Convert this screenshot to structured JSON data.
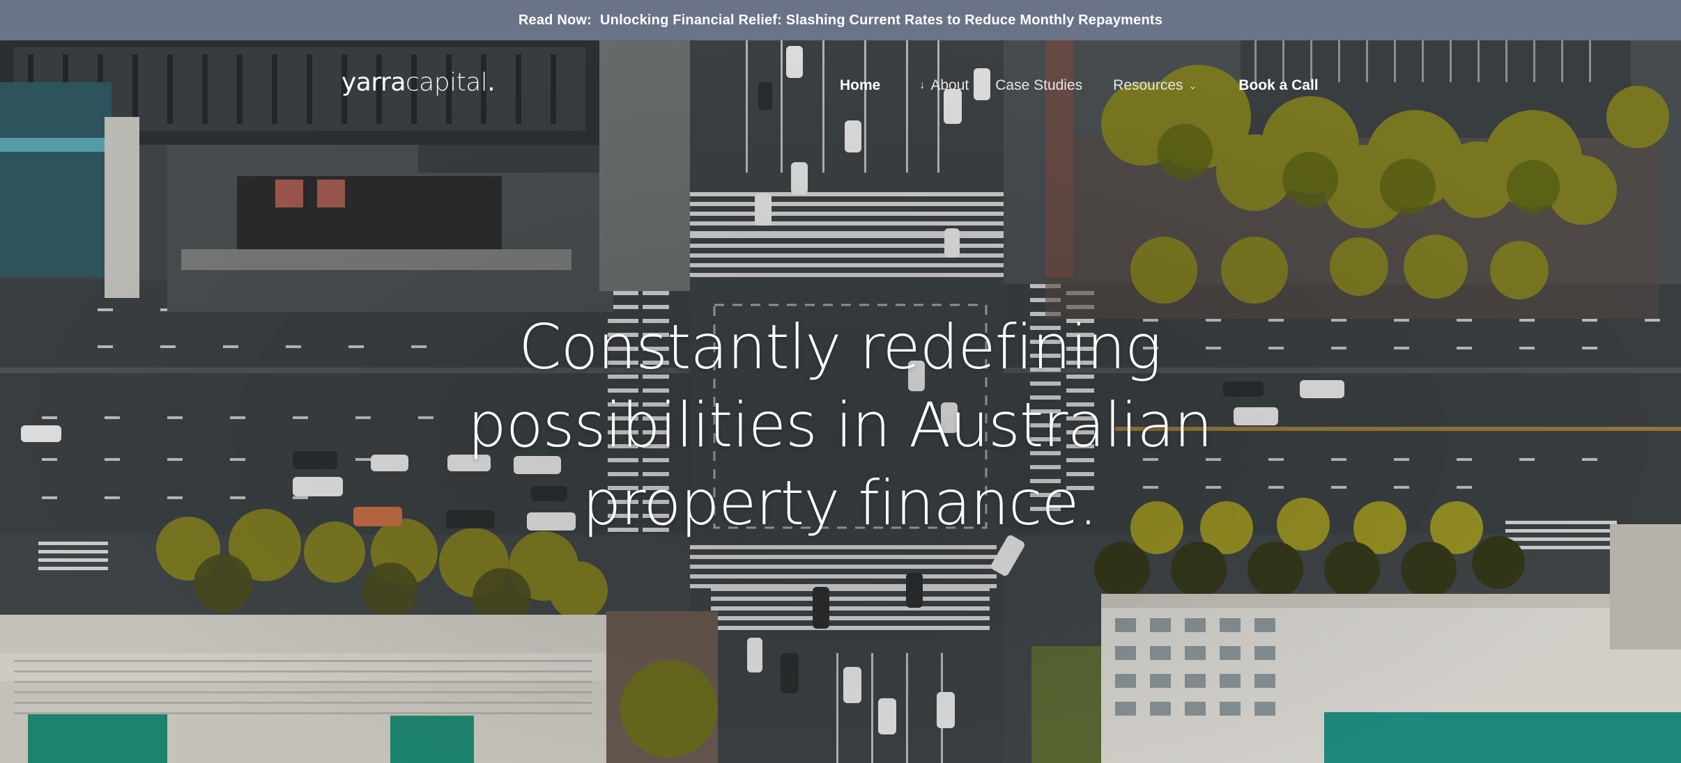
{
  "announcement": {
    "lead": "Read Now:",
    "link_text": "Unlocking Financial Relief: Slashing Current Rates to Reduce Monthly Repayments"
  },
  "logo": {
    "brand_main": "yarra",
    "brand_secondary": "capital",
    "dot": "."
  },
  "nav": {
    "home": "Home",
    "about": "About",
    "case_studies": "Case Studies",
    "resources": "Resources",
    "book_call": "Book a Call"
  },
  "hero": {
    "headline_line1": "Constantly redefining",
    "headline_line2": "possibilities in Australian",
    "headline_line3": "property finance."
  },
  "colors": {
    "announcement_bg": "#6b7388",
    "text": "#ffffff",
    "road": "#3f4447",
    "tree": "#8a8a2a",
    "building": "#d8d6cf"
  },
  "icons": {
    "about": "arrow-down-icon",
    "resources": "chevron-down-icon"
  }
}
